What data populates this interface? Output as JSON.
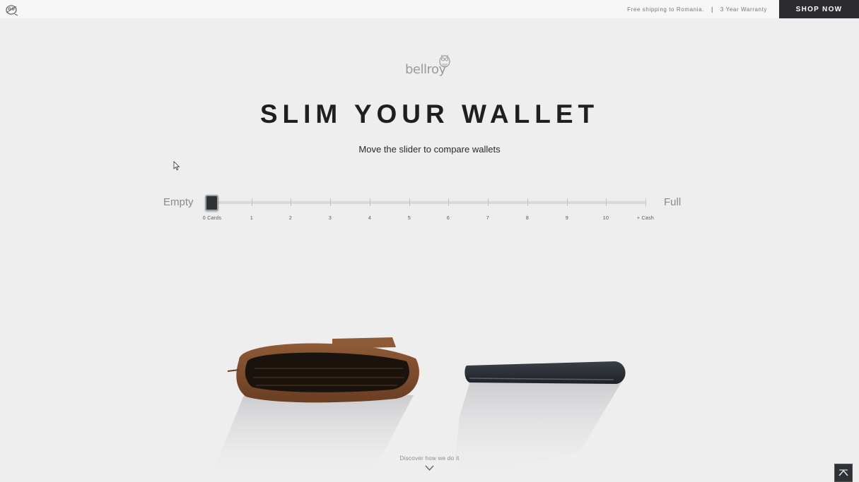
{
  "topbar": {
    "shipping_text": "Free shipping to Romania.",
    "separator": "|",
    "warranty_text": "3 Year Warranty",
    "shop_now": "SHOP NOW",
    "logo_icon": "owl-icon"
  },
  "brand": {
    "logo_text": "bellroy",
    "logo_icon": "owl-icon"
  },
  "hero": {
    "title": "SLIM YOUR WALLET",
    "subtitle": "Move the slider to compare wallets"
  },
  "slider": {
    "left_label": "Empty",
    "right_label": "Full",
    "ticks": [
      "0 Cards",
      "1",
      "2",
      "3",
      "4",
      "5",
      "6",
      "7",
      "8",
      "9",
      "10",
      "+ Cash"
    ],
    "selected_index": 0,
    "selected_value": "0 Cards"
  },
  "footer": {
    "discover_text": "Discover how we do it",
    "discover_icon": "chevron-down-icon",
    "back_to_top_icon": "chevron-up-icon"
  },
  "colors": {
    "background": "#eeeeef",
    "shop_button": "#2b2b30",
    "headline": "#1f1f22",
    "brown_wallet": "#7a4a2c",
    "slim_wallet": "#2a2e35"
  }
}
